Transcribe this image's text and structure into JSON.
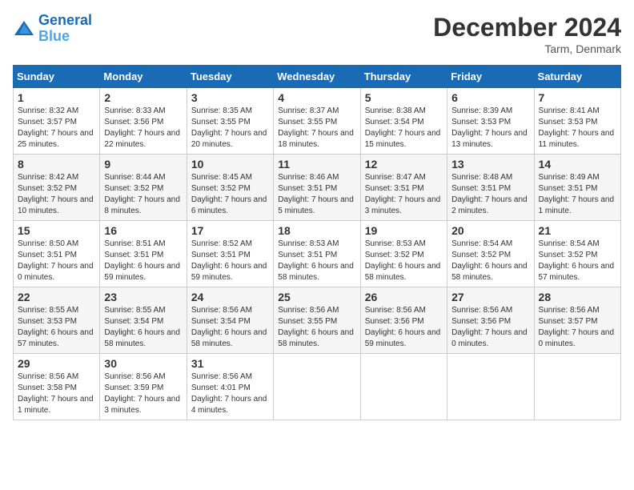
{
  "header": {
    "logo_line1": "General",
    "logo_line2": "Blue",
    "month_title": "December 2024",
    "subtitle": "Tarm, Denmark"
  },
  "days_of_week": [
    "Sunday",
    "Monday",
    "Tuesday",
    "Wednesday",
    "Thursday",
    "Friday",
    "Saturday"
  ],
  "weeks": [
    [
      {
        "day": 1,
        "sunrise": "Sunrise: 8:32 AM",
        "sunset": "Sunset: 3:57 PM",
        "daylight": "Daylight: 7 hours and 25 minutes."
      },
      {
        "day": 2,
        "sunrise": "Sunrise: 8:33 AM",
        "sunset": "Sunset: 3:56 PM",
        "daylight": "Daylight: 7 hours and 22 minutes."
      },
      {
        "day": 3,
        "sunrise": "Sunrise: 8:35 AM",
        "sunset": "Sunset: 3:55 PM",
        "daylight": "Daylight: 7 hours and 20 minutes."
      },
      {
        "day": 4,
        "sunrise": "Sunrise: 8:37 AM",
        "sunset": "Sunset: 3:55 PM",
        "daylight": "Daylight: 7 hours and 18 minutes."
      },
      {
        "day": 5,
        "sunrise": "Sunrise: 8:38 AM",
        "sunset": "Sunset: 3:54 PM",
        "daylight": "Daylight: 7 hours and 15 minutes."
      },
      {
        "day": 6,
        "sunrise": "Sunrise: 8:39 AM",
        "sunset": "Sunset: 3:53 PM",
        "daylight": "Daylight: 7 hours and 13 minutes."
      },
      {
        "day": 7,
        "sunrise": "Sunrise: 8:41 AM",
        "sunset": "Sunset: 3:53 PM",
        "daylight": "Daylight: 7 hours and 11 minutes."
      }
    ],
    [
      {
        "day": 8,
        "sunrise": "Sunrise: 8:42 AM",
        "sunset": "Sunset: 3:52 PM",
        "daylight": "Daylight: 7 hours and 10 minutes."
      },
      {
        "day": 9,
        "sunrise": "Sunrise: 8:44 AM",
        "sunset": "Sunset: 3:52 PM",
        "daylight": "Daylight: 7 hours and 8 minutes."
      },
      {
        "day": 10,
        "sunrise": "Sunrise: 8:45 AM",
        "sunset": "Sunset: 3:52 PM",
        "daylight": "Daylight: 7 hours and 6 minutes."
      },
      {
        "day": 11,
        "sunrise": "Sunrise: 8:46 AM",
        "sunset": "Sunset: 3:51 PM",
        "daylight": "Daylight: 7 hours and 5 minutes."
      },
      {
        "day": 12,
        "sunrise": "Sunrise: 8:47 AM",
        "sunset": "Sunset: 3:51 PM",
        "daylight": "Daylight: 7 hours and 3 minutes."
      },
      {
        "day": 13,
        "sunrise": "Sunrise: 8:48 AM",
        "sunset": "Sunset: 3:51 PM",
        "daylight": "Daylight: 7 hours and 2 minutes."
      },
      {
        "day": 14,
        "sunrise": "Sunrise: 8:49 AM",
        "sunset": "Sunset: 3:51 PM",
        "daylight": "Daylight: 7 hours and 1 minute."
      }
    ],
    [
      {
        "day": 15,
        "sunrise": "Sunrise: 8:50 AM",
        "sunset": "Sunset: 3:51 PM",
        "daylight": "Daylight: 7 hours and 0 minutes."
      },
      {
        "day": 16,
        "sunrise": "Sunrise: 8:51 AM",
        "sunset": "Sunset: 3:51 PM",
        "daylight": "Daylight: 6 hours and 59 minutes."
      },
      {
        "day": 17,
        "sunrise": "Sunrise: 8:52 AM",
        "sunset": "Sunset: 3:51 PM",
        "daylight": "Daylight: 6 hours and 59 minutes."
      },
      {
        "day": 18,
        "sunrise": "Sunrise: 8:53 AM",
        "sunset": "Sunset: 3:51 PM",
        "daylight": "Daylight: 6 hours and 58 minutes."
      },
      {
        "day": 19,
        "sunrise": "Sunrise: 8:53 AM",
        "sunset": "Sunset: 3:52 PM",
        "daylight": "Daylight: 6 hours and 58 minutes."
      },
      {
        "day": 20,
        "sunrise": "Sunrise: 8:54 AM",
        "sunset": "Sunset: 3:52 PM",
        "daylight": "Daylight: 6 hours and 58 minutes."
      },
      {
        "day": 21,
        "sunrise": "Sunrise: 8:54 AM",
        "sunset": "Sunset: 3:52 PM",
        "daylight": "Daylight: 6 hours and 57 minutes."
      }
    ],
    [
      {
        "day": 22,
        "sunrise": "Sunrise: 8:55 AM",
        "sunset": "Sunset: 3:53 PM",
        "daylight": "Daylight: 6 hours and 57 minutes."
      },
      {
        "day": 23,
        "sunrise": "Sunrise: 8:55 AM",
        "sunset": "Sunset: 3:54 PM",
        "daylight": "Daylight: 6 hours and 58 minutes."
      },
      {
        "day": 24,
        "sunrise": "Sunrise: 8:56 AM",
        "sunset": "Sunset: 3:54 PM",
        "daylight": "Daylight: 6 hours and 58 minutes."
      },
      {
        "day": 25,
        "sunrise": "Sunrise: 8:56 AM",
        "sunset": "Sunset: 3:55 PM",
        "daylight": "Daylight: 6 hours and 58 minutes."
      },
      {
        "day": 26,
        "sunrise": "Sunrise: 8:56 AM",
        "sunset": "Sunset: 3:56 PM",
        "daylight": "Daylight: 6 hours and 59 minutes."
      },
      {
        "day": 27,
        "sunrise": "Sunrise: 8:56 AM",
        "sunset": "Sunset: 3:56 PM",
        "daylight": "Daylight: 7 hours and 0 minutes."
      },
      {
        "day": 28,
        "sunrise": "Sunrise: 8:56 AM",
        "sunset": "Sunset: 3:57 PM",
        "daylight": "Daylight: 7 hours and 0 minutes."
      }
    ],
    [
      {
        "day": 29,
        "sunrise": "Sunrise: 8:56 AM",
        "sunset": "Sunset: 3:58 PM",
        "daylight": "Daylight: 7 hours and 1 minute."
      },
      {
        "day": 30,
        "sunrise": "Sunrise: 8:56 AM",
        "sunset": "Sunset: 3:59 PM",
        "daylight": "Daylight: 7 hours and 3 minutes."
      },
      {
        "day": 31,
        "sunrise": "Sunrise: 8:56 AM",
        "sunset": "Sunset: 4:01 PM",
        "daylight": "Daylight: 7 hours and 4 minutes."
      },
      null,
      null,
      null,
      null
    ]
  ]
}
